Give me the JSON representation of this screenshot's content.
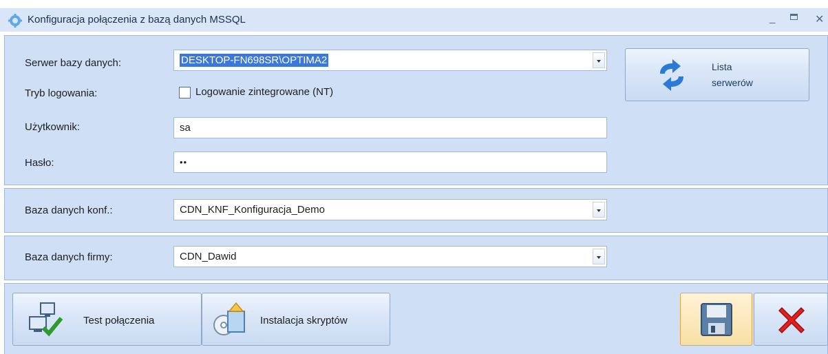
{
  "window": {
    "title": "Konfiguracja połączenia z bazą danych MSSQL",
    "minimize": "_",
    "close": "✕"
  },
  "server_section": {
    "server_label": "Serwer bazy danych:",
    "server_value": "DESKTOP-FN698SR\\OPTIMA2",
    "login_mode_label": "Tryb logowania:",
    "integrated_login_label": "Logowanie zintegrowane (NT)",
    "integrated_login_checked": false,
    "user_label": "Użytkownik:",
    "user_value": "sa",
    "password_label": "Hasło:",
    "password_value": "••",
    "server_list_button": [
      "Lista",
      "serwerów"
    ]
  },
  "config_db": {
    "label": "Baza danych konf.:",
    "value": "CDN_KNF_Konfiguracja_Demo"
  },
  "company_db": {
    "label": "Baza danych firmy:",
    "value": "CDN_Dawid"
  },
  "actions": {
    "test_connection": "Test połączenia",
    "install_scripts": "Instalacja skryptów"
  },
  "icons": [
    "gear-icon",
    "refresh-arrows-icon",
    "computer-check-icon",
    "install-package-icon",
    "save-floppy-icon",
    "cancel-x-icon"
  ]
}
